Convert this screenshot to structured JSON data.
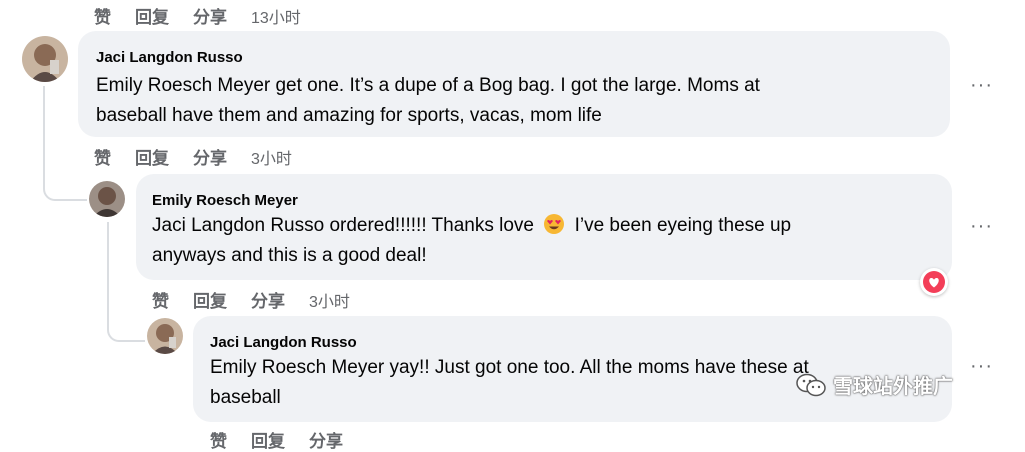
{
  "actions": {
    "like": "赞",
    "reply": "回复",
    "share": "分享"
  },
  "top_actions": {
    "time": "13小时"
  },
  "comments": [
    {
      "author": "Jaci Langdon Russo",
      "lines": [
        "Emily Roesch Meyer get one. It’s a dupe of a Bog bag. I got the large. Moms at",
        "baseball have them and amazing for sports, vacas, mom life"
      ],
      "time": "3小时",
      "more": "···"
    },
    {
      "author": "Emily Roesch Meyer",
      "line1_a": "Jaci Langdon Russo ordered!!!!!! Thanks love",
      "line1_b": "I’ve been eyeing these up",
      "line2": "anyways and this is a good deal!",
      "time": "3小时",
      "more": "···"
    },
    {
      "author": "Jaci Langdon Russo",
      "lines": [
        "Emily Roesch Meyer yay!! Just got one too. All the moms have these at",
        "baseball"
      ],
      "more": "···"
    }
  ],
  "watermark": "雪球站外推广",
  "colors": {
    "bubble": "#f0f2f5",
    "love": "#f33e58",
    "meta": "#65676b"
  }
}
